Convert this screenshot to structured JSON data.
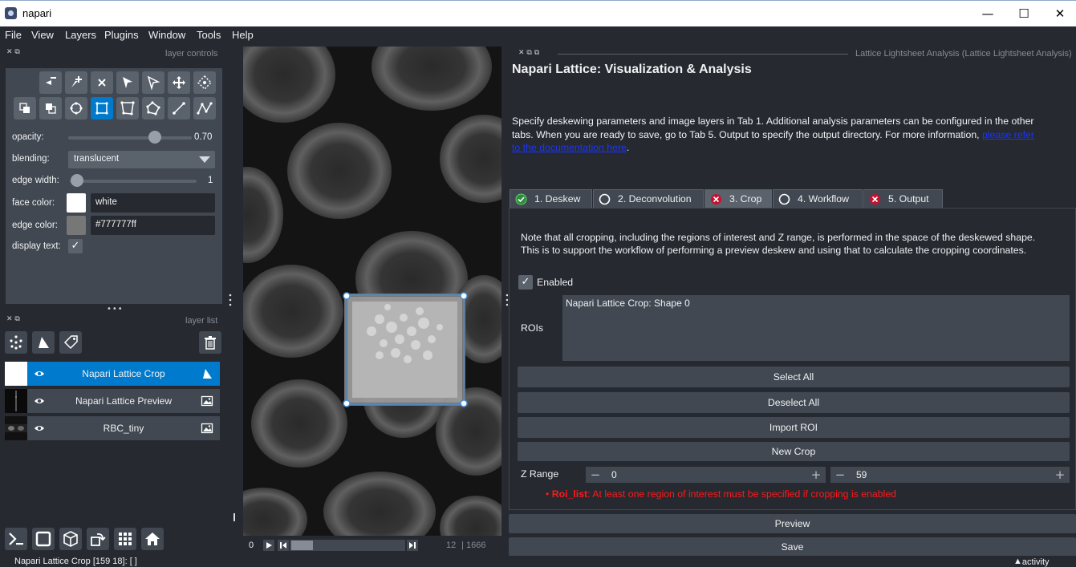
{
  "window": {
    "title": "napari",
    "minimize": "—",
    "maximize": "☐",
    "close": "✕"
  },
  "menu": [
    "File",
    "View",
    "Layers",
    "Plugins",
    "Window",
    "Tools",
    "Help"
  ],
  "layer_controls": {
    "header": "layer controls",
    "opacity_label": "opacity:",
    "opacity_value": "0.70",
    "opacity": 0.7,
    "blending_label": "blending:",
    "blending_value": "translucent",
    "edge_width_label": "edge width:",
    "edge_width_value": "1",
    "face_color_label": "face color:",
    "face_color_value": "white",
    "face_color": "#ffffff",
    "edge_color_label": "edge color:",
    "edge_color_value": "#777777ff",
    "edge_color": "#777777",
    "display_text_label": "display text:",
    "display_text_checked": "✓"
  },
  "layer_list": {
    "header": "layer list",
    "handle": "•••",
    "layers": [
      {
        "name": "Napari Lattice Crop",
        "type": "shapes",
        "selected": true
      },
      {
        "name": "Napari Lattice Preview",
        "type": "image",
        "selected": false
      },
      {
        "name": "RBC_tiny",
        "type": "image",
        "selected": false
      }
    ]
  },
  "dims": {
    "slice_value": "0",
    "current": "12",
    "total": "1666",
    "slider_position": 0.007
  },
  "plugin": {
    "window_title": "Lattice Lightsheet Analysis (Lattice Lightsheet Analysis)",
    "title": "Napari Lattice: Visualization & Analysis",
    "desc_line1": "Specify deskewing parameters and image layers in Tab 1.  Additional analysis parameters can be configured in the other",
    "desc_line2_prefix": "tabs.  When you are ready to save, go to Tab 5.  Output to specify the output directory.  For more information, ",
    "desc_link_part1": "please refer",
    "desc_link_part2": "to the documentation here",
    "desc_suffix": ".",
    "tabs": [
      {
        "label": "1. Deskew",
        "status": "ok"
      },
      {
        "label": "2. Deconvolution",
        "status": "off"
      },
      {
        "label": "3. Crop",
        "status": "error"
      },
      {
        "label": "4. Workflow",
        "status": "off"
      },
      {
        "label": "5. Output",
        "status": "error"
      }
    ],
    "crop": {
      "note_line1": "Note that all cropping, including the regions of interest and Z range, is performed in the space of the deskewed shape.",
      "note_line2": "This is to support the workflow of performing a preview deskew and using that to calculate the cropping coordinates.",
      "enabled_label": "Enabled",
      "enabled_checked": "✓",
      "rois_label": "ROIs",
      "rois_item": "Napari Lattice Crop: Shape 0",
      "select_all": "Select All",
      "deselect_all": "Deselect All",
      "import_roi": "Import ROI",
      "new_crop": "New Crop",
      "z_range_label": "Z Range",
      "z_min": "0",
      "z_max": "59",
      "error_bullet": "•",
      "error_key": "Roi_list",
      "error_msg": ": At least one region of interest must be specified if cropping is enabled"
    },
    "preview": "Preview",
    "save": "Save"
  },
  "status": {
    "left": "Napari Lattice Crop     [159 18]: [ ]",
    "right": "activity"
  }
}
